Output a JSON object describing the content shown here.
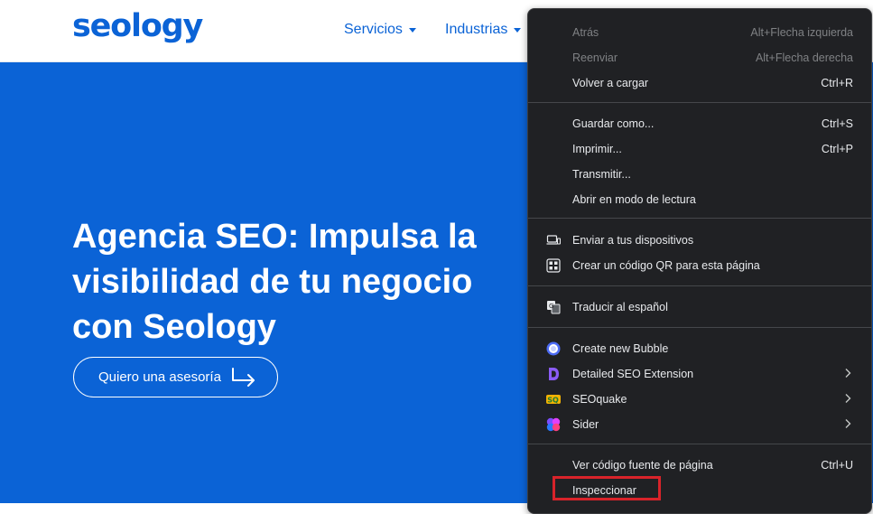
{
  "header": {
    "logo": "seology",
    "nav": [
      {
        "label": "Servicios"
      },
      {
        "label": "Industrias"
      }
    ]
  },
  "hero": {
    "title_lines": [
      "Agencia SEO: Impulsa la",
      "visibilidad de tu negocio",
      "con Seology"
    ],
    "cta_label": "Quiero una asesoría"
  },
  "context_menu": {
    "items": [
      {
        "label": "Atrás",
        "shortcut": "Alt+Flecha izquierda",
        "disabled": true
      },
      {
        "label": "Reenviar",
        "shortcut": "Alt+Flecha derecha",
        "disabled": true
      },
      {
        "label": "Volver a cargar",
        "shortcut": "Ctrl+R"
      },
      {
        "label": "Guardar como...",
        "shortcut": "Ctrl+S"
      },
      {
        "label": "Imprimir...",
        "shortcut": "Ctrl+P"
      },
      {
        "label": "Transmitir..."
      },
      {
        "label": "Abrir en modo de lectura"
      },
      {
        "label": "Enviar a tus dispositivos",
        "icon": "devices-icon"
      },
      {
        "label": "Crear un código QR para esta página",
        "icon": "qr-code-icon"
      },
      {
        "label": "Traducir al español",
        "icon": "translate-icon"
      },
      {
        "label": "Create new Bubble",
        "icon": "bubble-extension-icon"
      },
      {
        "label": "Detailed SEO Extension",
        "icon": "detailed-seo-icon",
        "submenu": true
      },
      {
        "label": "SEOquake",
        "icon": "seoquake-icon",
        "submenu": true
      },
      {
        "label": "Sider",
        "icon": "sider-icon",
        "submenu": true
      },
      {
        "label": "Ver código fuente de página",
        "shortcut": "Ctrl+U"
      },
      {
        "label": "Inspeccionar",
        "highlighted": true
      }
    ]
  },
  "colors": {
    "brand_blue": "#0b63d6",
    "menu_bg": "#202124",
    "highlight_red": "#d8232a"
  }
}
